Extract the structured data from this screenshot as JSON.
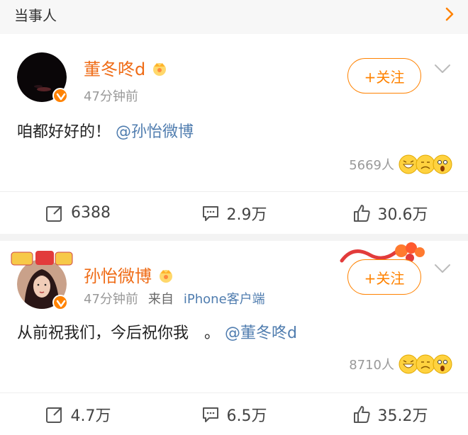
{
  "section": {
    "title": "当事人"
  },
  "posts": [
    {
      "username": "董冬咚d",
      "time": "47分钟前",
      "source": "",
      "client": "",
      "follow_label": "+关注",
      "text": "咱都好好的！",
      "mention": "@孙怡微博",
      "reaction_count": "5669人",
      "repost": "6388",
      "comment": "2.9万",
      "like": "30.6万"
    },
    {
      "username": "孙怡微博",
      "time": "47分钟前",
      "source": "来自",
      "client": "iPhone客户端",
      "follow_label": "+关注",
      "text": "从前祝我们，今后祝你我　。",
      "mention": "@董冬咚d",
      "reaction_count": "8710人",
      "repost": "4.7万",
      "comment": "6.5万",
      "like": "35.2万"
    }
  ],
  "colors": {
    "accent": "#ff8200",
    "username": "#ef6c17",
    "link": "#507daf"
  }
}
